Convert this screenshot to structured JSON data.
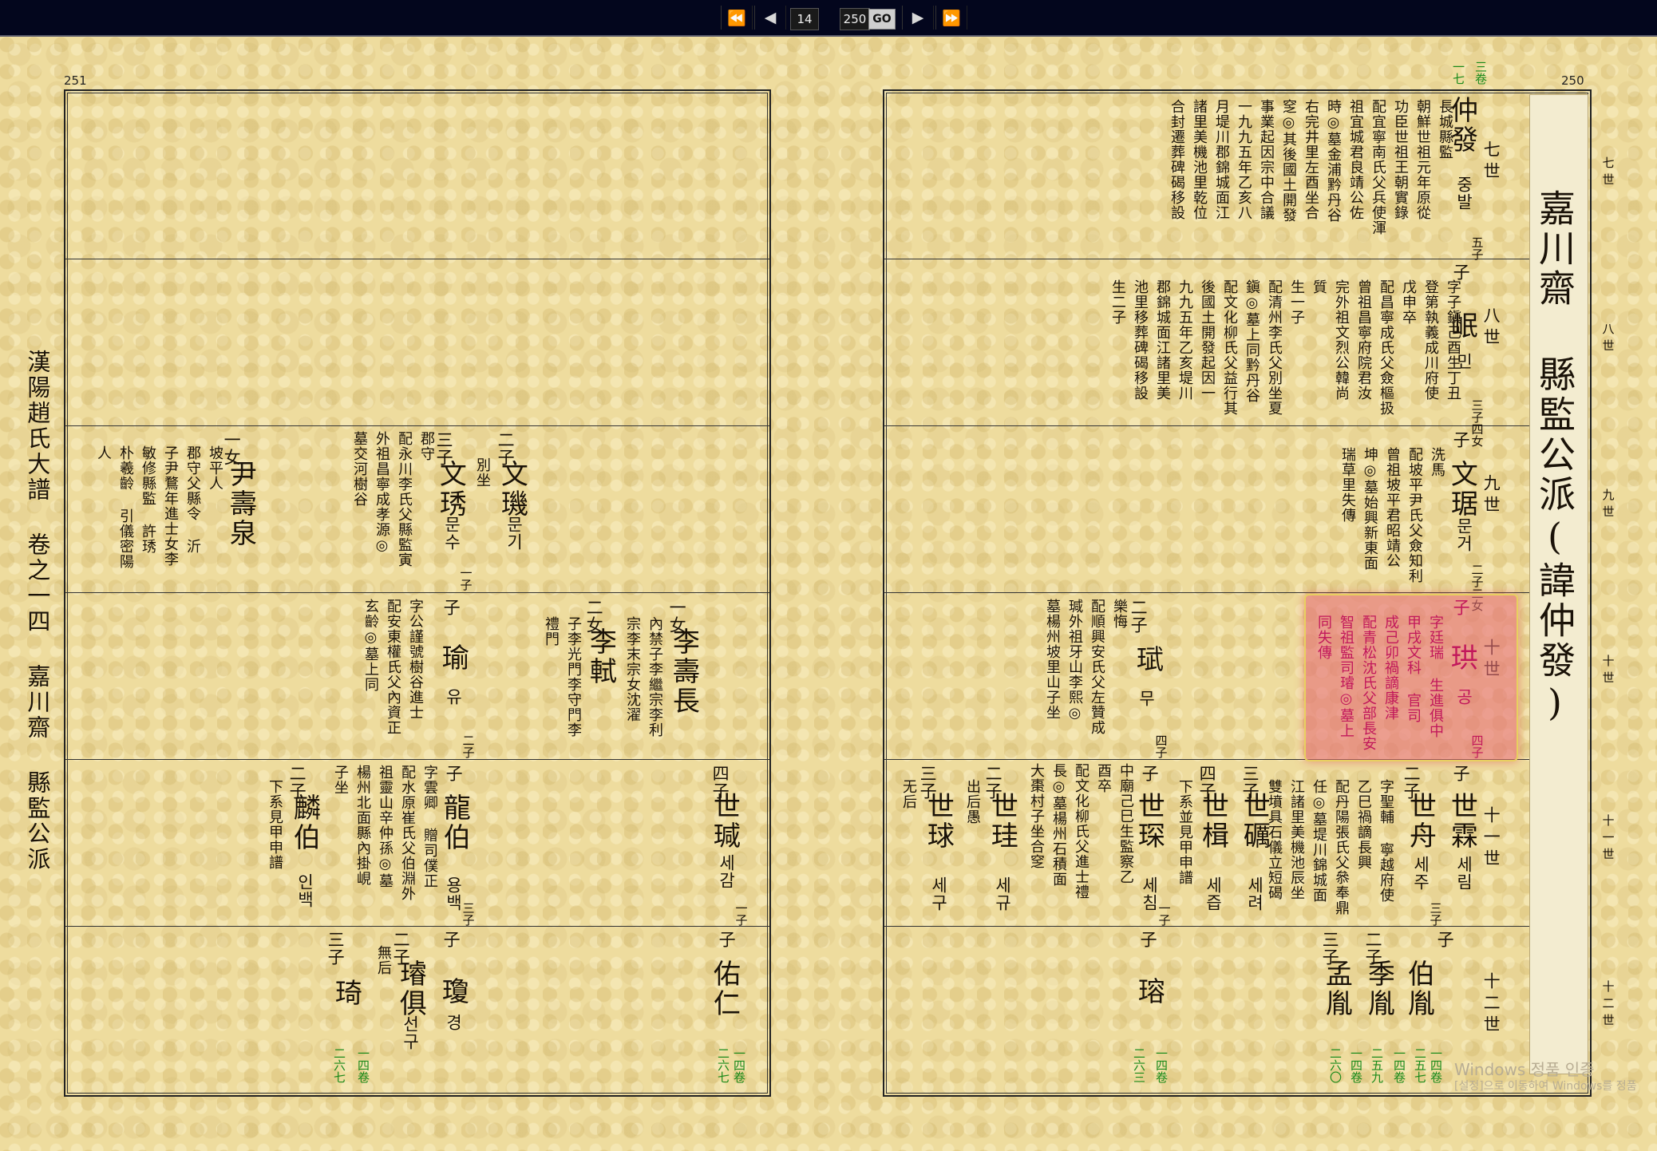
{
  "nav": {
    "first": "⏪",
    "prev": "◀",
    "current": "14",
    "total": "250",
    "go": "GO",
    "next": "▶",
    "last": "⏩"
  },
  "left_page": {
    "number": "251",
    "spine": "漢陽趙氏大譜 卷之一四 嘉川齋 縣監公派",
    "entries": [
      {
        "rel": "二子",
        "name": "文璣",
        "hangul": "문기",
        "bio": "別坐",
        "count": ""
      },
      {
        "rel": "三子",
        "name": "文琇",
        "hangul": "문수",
        "bio": "郡守\n配永川李氏父縣監寅\n外祖昌寧成孝源◎\n墓交河樹谷",
        "count": "一子"
      },
      {
        "rel": "一女",
        "name": "尹壽泉",
        "hangul": "",
        "bio": "坡平人\n郡守父縣令 沂\n子尹鶩年進士女李\n敏修縣監 許琇\n朴羲齡 引儀密陽\n人",
        "count": ""
      },
      {
        "rel": "一女",
        "name": "李壽長",
        "hangul": "",
        "bio": "內禁子李繼宗李利\n宗李末宗女沈濯",
        "count": ""
      },
      {
        "rel": "二女",
        "name": "李軾",
        "hangul": "",
        "bio": "子李光門李守門李\n禮門",
        "count": ""
      },
      {
        "rel": "子",
        "name": "瑜",
        "hangul": "유",
        "bio": "字公謹號樹谷進士\n配安東權氏父內資正\n玄齡◎墓上同",
        "count": "二子"
      },
      {
        "rel": "四子",
        "name": "世瑊",
        "hangul": "세감",
        "bio": "",
        "count": "一子"
      },
      {
        "rel": "子",
        "name": "龍伯",
        "hangul": "용백",
        "bio": "字雲卿 贈司僕正\n配水原崔氏父伯淵外\n祖靈山辛仲孫◎墓\n楊州北面縣內掛峴\n子坐",
        "count": "三子"
      },
      {
        "rel": "二子",
        "name": "麟伯",
        "hangul": "인백",
        "bio": "下系見甲申譜",
        "count": ""
      },
      {
        "rel": "子",
        "name": "佑仁",
        "hangul": "",
        "bio": "",
        "count": ""
      },
      {
        "rel": "子",
        "name": "瓊",
        "hangul": "경",
        "bio": "",
        "count": ""
      },
      {
        "rel": "二子",
        "name": "璿俱",
        "hangul": "선구",
        "bio": "無后",
        "count": ""
      },
      {
        "rel": "三子",
        "name": "琦",
        "hangul": "",
        "bio": "",
        "count": ""
      }
    ],
    "refs": [
      {
        "text": "一四卷",
        "page": "二六七"
      },
      {
        "text": "一四卷",
        "page": "二六七"
      }
    ]
  },
  "right_page": {
    "number": "250",
    "title": "嘉川齋 縣監公派(諱仲發)",
    "ref_top": {
      "text": "三卷",
      "page": "一七"
    },
    "generations": [
      "七世",
      "八世",
      "九世",
      "十世",
      "十一世",
      "十二世"
    ],
    "entries": [
      {
        "rel": "",
        "name": "仲發",
        "hangul": "중발",
        "bio": "長城縣監\n朝鮮世祖元年原從\n功臣世祖王朝實錄\n配宜寧南氏父兵使渾\n祖宜城君良靖公佐\n時◎墓金浦黔丹谷\n右完井里左酉坐合\n窆◎其後國土開發\n事業起因宗中合議\n一九九五年乙亥八\n月堤川郡錦城面江\n諸里美機池里乾位\n合封遷葬碑碣移設",
        "count": "五子"
      },
      {
        "rel": "子",
        "name": "岷",
        "hangul": "민",
        "bio": "字子鎭己酉生丁丑\n登第執義成川府使\n戊申卒\n配昌寧成氏父僉樞扱\n曾祖昌寧府院君汝\n完外祖文烈公韓尚\n質\n生一子\n配清州李氏父別坐夏\n鎭◎墓上同黔丹谷\n配文化柳氏父益行其\n後國土開發起因一\n九九五年乙亥堤川\n郡錦城面江諸里美\n池里移葬碑碣移設\n生二子",
        "count": "三子四女"
      },
      {
        "rel": "子",
        "name": "文琚",
        "hangul": "문거",
        "bio": "洗馬\n配坡平尹氏父僉知利\n曾祖坡平君昭靖公\n坤◎墓始興新東面\n瑞草里失傳",
        "count": "二子二女"
      },
      {
        "rel": "子",
        "name": "珙",
        "hangul": "공",
        "bio": "字廷瑞 生進俱中\n甲戌文科 官司\n成己卯禍謫康津\n配青松沈氏父部長安\n智祖監司璿◎墓上\n同失傳",
        "count": "四子",
        "highlight": true
      },
      {
        "rel": "二子",
        "name": "珷",
        "hangul": "무",
        "bio": "樂悔\n配順興安氏父左贊成\n瑊外祖牙山李熙◎\n墓楊州坡里山子坐",
        "count": "四子"
      },
      {
        "rel": "子",
        "name": "世霖",
        "hangul": "세림",
        "bio": "",
        "count": ""
      },
      {
        "rel": "二子",
        "name": "世舟",
        "hangul": "세주",
        "bio": "字聖輔 寧越府使\n乙巳禍謫長興\n配丹陽張氏父叅奉鼎\n任◎墓堤川錦城面\n江諸里美機池辰坐\n雙墳具石儀立短碣",
        "count": "三子"
      },
      {
        "rel": "三子",
        "name": "世礪",
        "hangul": "세려",
        "bio": "",
        "count": ""
      },
      {
        "rel": "四子",
        "name": "世楫",
        "hangul": "세즙",
        "bio": "下系並見甲申譜",
        "count": ""
      },
      {
        "rel": "子",
        "name": "世琛",
        "hangul": "세침",
        "bio": "中廟己巳生監察乙\n酉卒\n配文化柳氏父進士禮\n長◎墓楊州石積面\n大棗村子坐合窆",
        "count": "一子"
      },
      {
        "rel": "二子",
        "name": "世珪",
        "hangul": "세규",
        "bio": "出后愚",
        "count": ""
      },
      {
        "rel": "三子",
        "name": "世球",
        "hangul": "세구",
        "bio": "无后",
        "count": ""
      },
      {
        "rel": "子",
        "name": "伯胤",
        "hangul": "",
        "bio": "",
        "count": ""
      },
      {
        "rel": "二子",
        "name": "季胤",
        "hangul": "",
        "bio": "",
        "count": ""
      },
      {
        "rel": "三子",
        "name": "孟胤",
        "hangul": "",
        "bio": "",
        "count": ""
      },
      {
        "rel": "子",
        "name": "瑢",
        "hangul": "",
        "bio": "",
        "count": ""
      }
    ],
    "refs": [
      {
        "text": "一四卷",
        "page": "二五七"
      },
      {
        "text": "一四卷",
        "page": "二五九"
      },
      {
        "text": "一四卷",
        "page": "二六〇"
      },
      {
        "text": "一四卷",
        "page": "二六三"
      }
    ]
  },
  "watermark": {
    "line1": "Windows 정품 인증",
    "line2": "[설정]으로 이동하여 Windows를 정품"
  }
}
